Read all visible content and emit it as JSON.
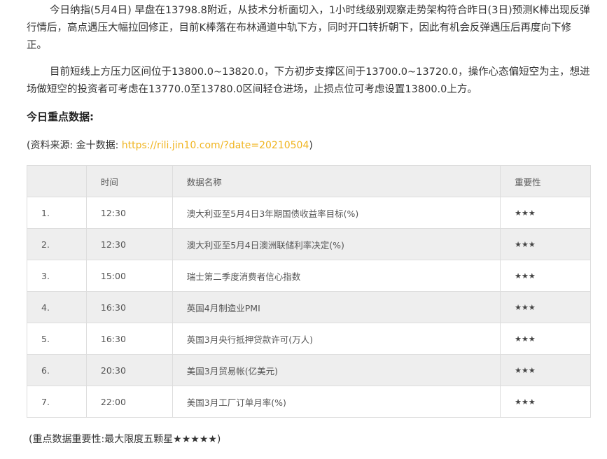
{
  "article": {
    "paragraph1": "今日纳指(5月4日) 早盘在13798.8附近，从技术分析面切入，1小时线级别观察走势架构符合昨日(3日)预测K棒出现反弹行情后，高点遇压大幅拉回修正，目前K棒落在布林通道中轨下方，同时开口转折朝下，因此有机会反弹遇压后再度向下修正。",
    "paragraph2": "目前短线上方压力区间位于13800.0~13820.0，下方初步支撑区间于13700.0~13720.0，操作心态偏短空为主，想进场做短空的投资者可考虑在13770.0至13780.0区间轻仓进场，止损点位可考虑设置13800.0上方。",
    "section_heading": "今日重点数据:",
    "source_prefix": "(资料来源: 金十数据: ",
    "source_link": "https://rili.jin10.com/?date=20210504",
    "source_suffix": ")",
    "footnote": "(重点数据重要性:最大限度五颗星★★★★★)"
  },
  "table": {
    "headers": [
      "",
      "时间",
      "数据名称",
      "重要性"
    ],
    "rows": [
      {
        "index": "1.",
        "time": "12:30",
        "name": "澳大利亚至5月4日3年期国债收益率目标(%)",
        "importance": "★★★"
      },
      {
        "index": "2.",
        "time": "12:30",
        "name": "澳大利亚至5月4日澳洲联储利率决定(%)",
        "importance": "★★★"
      },
      {
        "index": "3.",
        "time": "15:00",
        "name": "瑞士第二季度消费者信心指数",
        "importance": "★★★"
      },
      {
        "index": "4.",
        "time": "16:30",
        "name": "英国4月制造业PMI",
        "importance": "★★★"
      },
      {
        "index": "5.",
        "time": "16:30",
        "name": "英国3月央行抵押贷款许可(万人)",
        "importance": "★★★"
      },
      {
        "index": "6.",
        "time": "20:30",
        "name": "美国3月贸易帐(亿美元)",
        "importance": "★★★"
      },
      {
        "index": "7.",
        "time": "22:00",
        "name": "美国3月工厂订单月率(%)",
        "importance": "★★★"
      }
    ]
  },
  "colors": {
    "link": "#f0b41e",
    "header_bg": "#eeeeee",
    "stripe_bg": "#eeeeee",
    "border": "#dddddd"
  }
}
